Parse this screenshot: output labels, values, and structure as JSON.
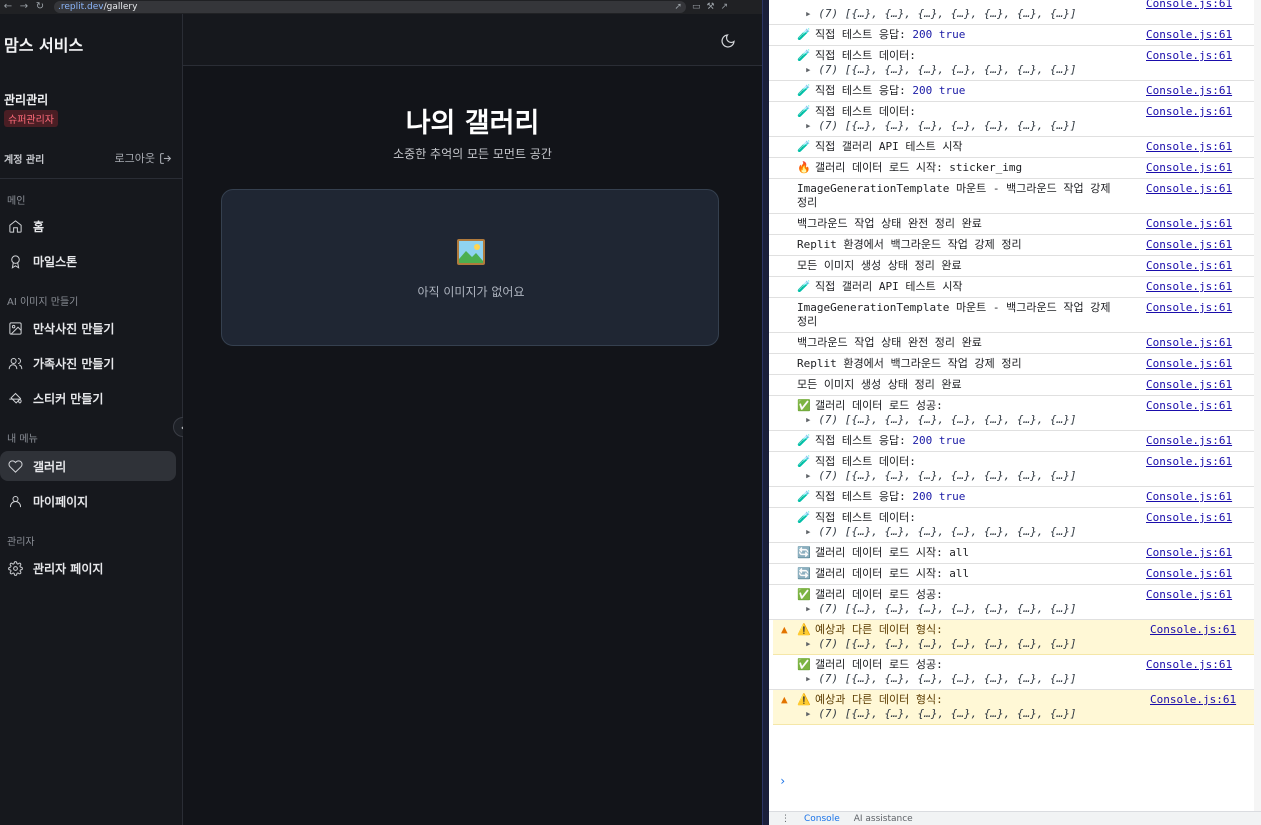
{
  "browser": {
    "url_host": ".replit.dev",
    "url_path": "/gallery"
  },
  "sidebar": {
    "brand": "맘스 서비스",
    "admin_name": "관리관리",
    "admin_badge": "슈퍼관리자",
    "account_label": "계정 관리",
    "logout_label": "로그아웃",
    "sections": [
      {
        "title": "메인",
        "items": [
          "홈",
          "마일스톤"
        ]
      },
      {
        "title": "AI 이미지 만들기",
        "items": [
          "만삭사진 만들기",
          "가족사진 만들기",
          "스티커 만들기"
        ]
      },
      {
        "title": "내 메뉴",
        "items": [
          "갤러리",
          "마이페이지"
        ]
      },
      {
        "title": "관리자",
        "items": [
          "관리자 페이지"
        ]
      }
    ],
    "active_item": "갤러리"
  },
  "main": {
    "title": "나의 갤러리",
    "subtitle": "소중한 추억의 모든 모먼트 공간",
    "empty_text": "아직 이미지가 없어요"
  },
  "console": {
    "source": "Console.js:61",
    "array_preview": "(7) [{…}, {…}, {…}, {…}, {…}, {…}, {…}]",
    "rows": [
      {
        "icon": "✅",
        "text": "",
        "sub": true,
        "partial": true
      },
      {
        "icon": "🧪",
        "text": "직접 테스트 응답: ",
        "num": "200 true"
      },
      {
        "icon": "🧪",
        "text": "직접 테스트 데이터:",
        "sub": true
      },
      {
        "icon": "🧪",
        "text": "직접 테스트 응답: ",
        "num": "200 true"
      },
      {
        "icon": "🧪",
        "text": "직접 테스트 데이터:",
        "sub": true
      },
      {
        "icon": "🧪",
        "text": "직접 갤러리 API 테스트 시작"
      },
      {
        "icon": "🔥",
        "text": "갤러리 데이터 로드 시작: sticker_img"
      },
      {
        "icon": "",
        "text": "ImageGenerationTemplate 마운트 - 백그라운드 작업 강제 정리"
      },
      {
        "icon": "",
        "text": "백그라운드 작업 상태 완전 정리 완료"
      },
      {
        "icon": "",
        "text": "Replit 환경에서 백그라운드 작업 강제 정리"
      },
      {
        "icon": "",
        "text": "모든 이미지 생성 상태 정리 완료"
      },
      {
        "icon": "🧪",
        "text": "직접 갤러리 API 테스트 시작"
      },
      {
        "icon": "",
        "text": "ImageGenerationTemplate 마운트 - 백그라운드 작업 강제 정리"
      },
      {
        "icon": "",
        "text": "백그라운드 작업 상태 완전 정리 완료"
      },
      {
        "icon": "",
        "text": "Replit 환경에서 백그라운드 작업 강제 정리"
      },
      {
        "icon": "",
        "text": "모든 이미지 생성 상태 정리 완료"
      },
      {
        "icon": "✅",
        "text": "갤러리 데이터 로드 성공:",
        "sub": true
      },
      {
        "icon": "🧪",
        "text": "직접 테스트 응답: ",
        "num": "200 true"
      },
      {
        "icon": "🧪",
        "text": "직접 테스트 데이터:",
        "sub": true
      },
      {
        "icon": "🧪",
        "text": "직접 테스트 응답: ",
        "num": "200 true"
      },
      {
        "icon": "🧪",
        "text": "직접 테스트 데이터:",
        "sub": true
      },
      {
        "icon": "🔄",
        "text": "갤러리 데이터 로드 시작: all"
      },
      {
        "icon": "🔄",
        "text": "갤러리 데이터 로드 시작: all"
      },
      {
        "icon": "✅",
        "text": "갤러리 데이터 로드 성공:",
        "sub": true
      },
      {
        "icon": "⚠️",
        "text": "예상과 다른 데이터 형식:",
        "sub": true,
        "warn": true
      },
      {
        "icon": "✅",
        "text": "갤러리 데이터 로드 성공:",
        "sub": true
      },
      {
        "icon": "⚠️",
        "text": "예상과 다른 데이터 형식:",
        "sub": true,
        "warn": true
      }
    ],
    "tabs": [
      "Console",
      "AI assistance"
    ]
  }
}
